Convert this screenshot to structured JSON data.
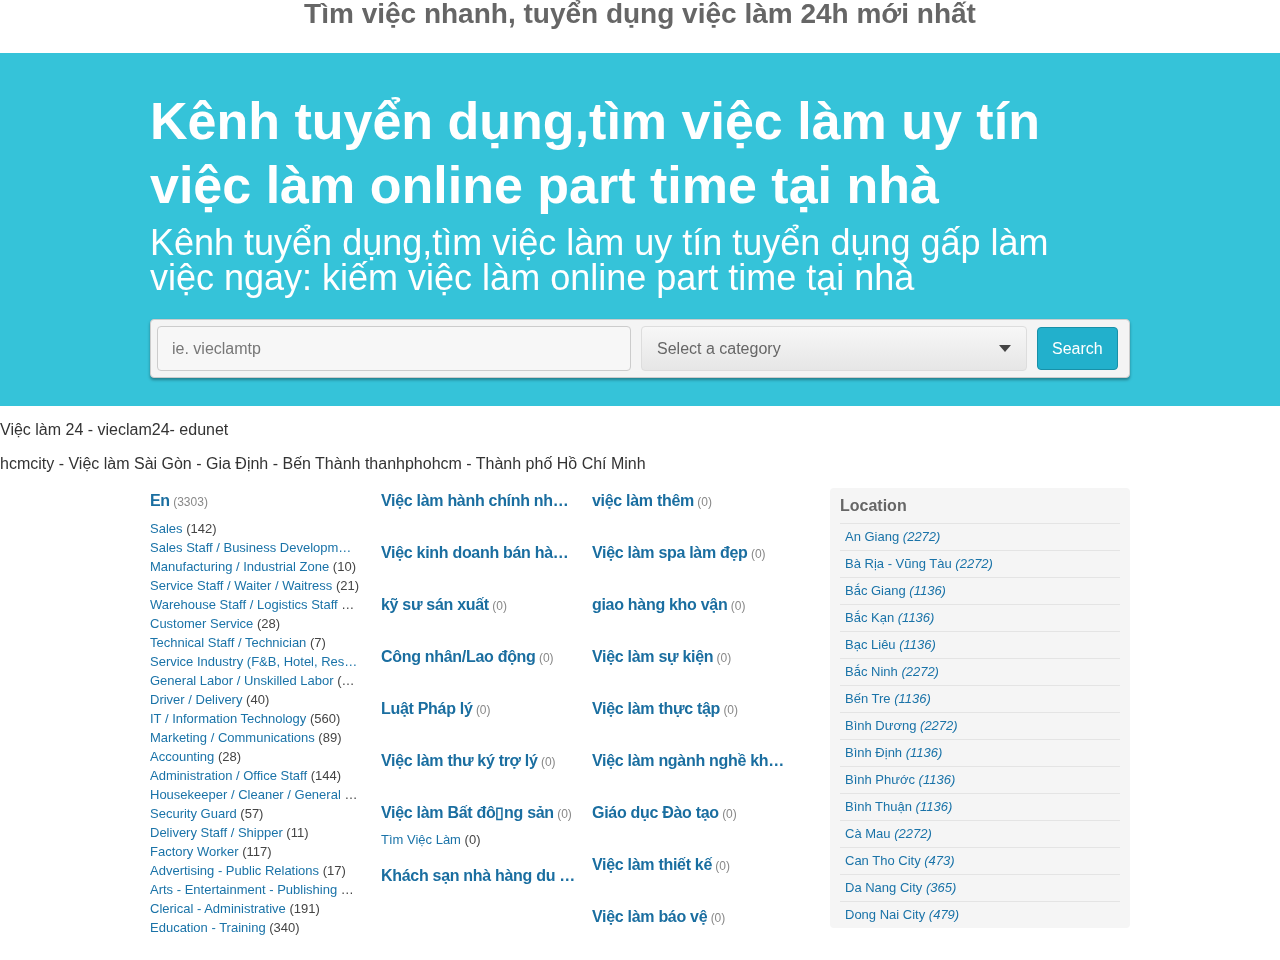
{
  "site_title": "Tìm việc nhanh, tuyển dụng việc làm 24h mới nhất",
  "hero": {
    "title": "Kênh tuyển dụng,tìm việc làm uy tín việc làm online part time tại nhà",
    "subtitle": "Kênh tuyển dụng,tìm việc làm uy tín tuyển dụng gấp làm việc ngay: kiếm việc làm online part time tại nhà"
  },
  "search": {
    "placeholder": "ie. vieclamtp",
    "category_placeholder": "Select a category",
    "button": "Search"
  },
  "lines": [
    "Việc làm 24 - vieclam24- edunet",
    "hcmcity - Việc làm Sài Gòn - Gia Định - Bến Thành thanhphohcm - Thành phố Hồ Chí Minh"
  ],
  "category_columns": [
    [
      {
        "name": "En",
        "count": "(3303)",
        "children": [
          {
            "name": "Sales",
            "count": "(142)"
          },
          {
            "name": "Sales Staff / Business Developm…"
          },
          {
            "name": "Manufacturing / Industrial Zone",
            "count": "(10)"
          },
          {
            "name": "Service Staff / Waiter / Waitress",
            "count": "(21)"
          },
          {
            "name": "Warehouse Staff / Logistics Staff",
            "count": "…"
          },
          {
            "name": "Customer Service",
            "count": "(28)"
          },
          {
            "name": "Technical Staff / Technician",
            "count": "(7)"
          },
          {
            "name": "Service Industry (F&B, Hotel, Res…"
          },
          {
            "name": "General Labor / Unskilled Labor",
            "count": "(…"
          },
          {
            "name": "Driver / Delivery",
            "count": "(40)"
          },
          {
            "name": "IT / Information Technology",
            "count": "(560)"
          },
          {
            "name": "Marketing / Communications",
            "count": "(89)"
          },
          {
            "name": "Accounting",
            "count": "(28)"
          },
          {
            "name": "Administration / Office Staff",
            "count": "(144)"
          },
          {
            "name": "Housekeeper / Cleaner / General",
            "count": "…"
          },
          {
            "name": "Security Guard",
            "count": "(57)"
          },
          {
            "name": "Delivery Staff / Shipper",
            "count": "(11)"
          },
          {
            "name": "Factory Worker",
            "count": "(117)"
          },
          {
            "name": "Advertising - Public Relations",
            "count": "(17)"
          },
          {
            "name": "Arts - Entertainment - Publishing",
            "count": "…"
          },
          {
            "name": "Clerical - Administrative",
            "count": "(191)"
          },
          {
            "name": "Education - Training",
            "count": "(340)"
          }
        ]
      }
    ],
    [
      {
        "name": "Việc làm hành chính nh…"
      },
      {
        "name": "Việc kinh doanh bán hà…"
      },
      {
        "name": "kỹ sư sán xuất",
        "count": "(0)"
      },
      {
        "name": "Công nhân/Lao động",
        "count": "(0)"
      },
      {
        "name": "Luật Pháp lý",
        "count": "(0)"
      },
      {
        "name": "Việc làm thư ký trợ lý",
        "count": "(0)"
      },
      {
        "name": "Việc làm Bất đô▯ng sản",
        "count": "(0)",
        "children": [
          {
            "name": "Tìm Việc Làm",
            "count": "(0)"
          }
        ]
      },
      {
        "name": "Khách sạn nhà hàng du …"
      }
    ],
    [
      {
        "name": "việc làm thêm",
        "count": "(0)"
      },
      {
        "name": "Việc làm spa làm đẹp",
        "count": "(0)"
      },
      {
        "name": "giao hàng kho vận",
        "count": "(0)"
      },
      {
        "name": "Việc làm sự kiện",
        "count": "(0)"
      },
      {
        "name": "Việc làm thực tập",
        "count": "(0)"
      },
      {
        "name": "Việc làm ngành nghề kh…"
      },
      {
        "name": "Giáo dục Đào tạo",
        "count": "(0)"
      },
      {
        "name": "Việc làm thiết kế",
        "count": "(0)"
      },
      {
        "name": "Việc làm báo vệ",
        "count": "(0)"
      }
    ]
  ],
  "location": {
    "title": "Location",
    "items": [
      {
        "name": "An Giang",
        "count": "(2272)"
      },
      {
        "name": "Bà Rịa - Vũng Tàu",
        "count": "(2272)"
      },
      {
        "name": "Bắc Giang",
        "count": "(1136)"
      },
      {
        "name": "Bắc Kạn",
        "count": "(1136)"
      },
      {
        "name": "Bạc Liêu",
        "count": "(1136)"
      },
      {
        "name": "Bắc Ninh",
        "count": "(2272)"
      },
      {
        "name": "Bến Tre",
        "count": "(1136)"
      },
      {
        "name": "Bình Dương",
        "count": "(2272)"
      },
      {
        "name": "Bình Định",
        "count": "(1136)"
      },
      {
        "name": "Bình Phước",
        "count": "(1136)"
      },
      {
        "name": "Bình Thuận",
        "count": "(1136)"
      },
      {
        "name": "Cà Mau",
        "count": "(2272)"
      },
      {
        "name": "Can Tho City",
        "count": "(473)"
      },
      {
        "name": "Da Nang City",
        "count": "(365)"
      },
      {
        "name": "Dong Nai City",
        "count": "(479)"
      }
    ]
  }
}
